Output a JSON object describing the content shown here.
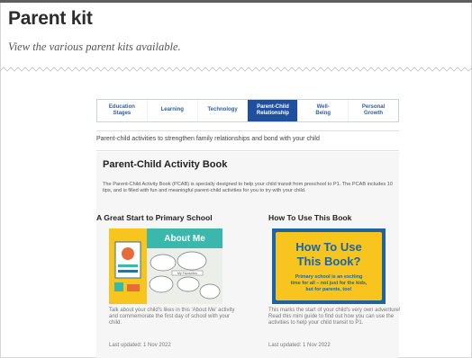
{
  "page": {
    "title": "Parent kit",
    "subtitle": "View the various parent kits available."
  },
  "tabs": [
    {
      "line1": "Education",
      "line2": "Stages",
      "active": false
    },
    {
      "line1": "Learning",
      "line2": "",
      "active": false
    },
    {
      "line1": "Technology",
      "line2": "",
      "active": false
    },
    {
      "line1": "Parent-Child",
      "line2": "Relationship",
      "active": true
    },
    {
      "line1": "Well-",
      "line2": "Being",
      "active": false
    },
    {
      "line1": "Personal",
      "line2": "Growth",
      "active": false
    }
  ],
  "intro_text": "Parent-child activities to strengthen family relationships and bond with your child",
  "section": {
    "title": "Parent-Child Activity Book",
    "description": "The Parent-Child Activity Book (PCAB) is specially designed to help your child transit from preschool to P1. The PCAB includes 10 tips, and is filled with fun and meaningful parent-child activities for you to try with your child."
  },
  "cards": [
    {
      "title": "A Great Start to Primary School",
      "image_text": "About Me",
      "image_small_text": "My Favourites",
      "description": "Talk about your child's likes in this 'About Me' activity and commemorate the first day of school with your child.",
      "updated": "Last updated: 1 Nov 2022"
    },
    {
      "title": "How To Use This Book",
      "image_heading_1": "How To Use",
      "image_heading_2": "This Book?",
      "image_body_1": "Primary school is an exciting",
      "image_body_2": "time for all – not just for the kids,",
      "image_body_3": "but for parents, too!",
      "description": "This marks the start of your child's very own adventure! Read this mini guide to find out how you can use the activities to help your child transit to P1.",
      "updated": "Last updated: 1 Nov 2022"
    }
  ],
  "colors": {
    "tab_active_bg": "#1f4f9e",
    "tab_text": "#2f5fa5",
    "image_yellow": "#f7c51e",
    "image_teal": "#3cb7ab",
    "image_blue": "#1e64a3"
  }
}
